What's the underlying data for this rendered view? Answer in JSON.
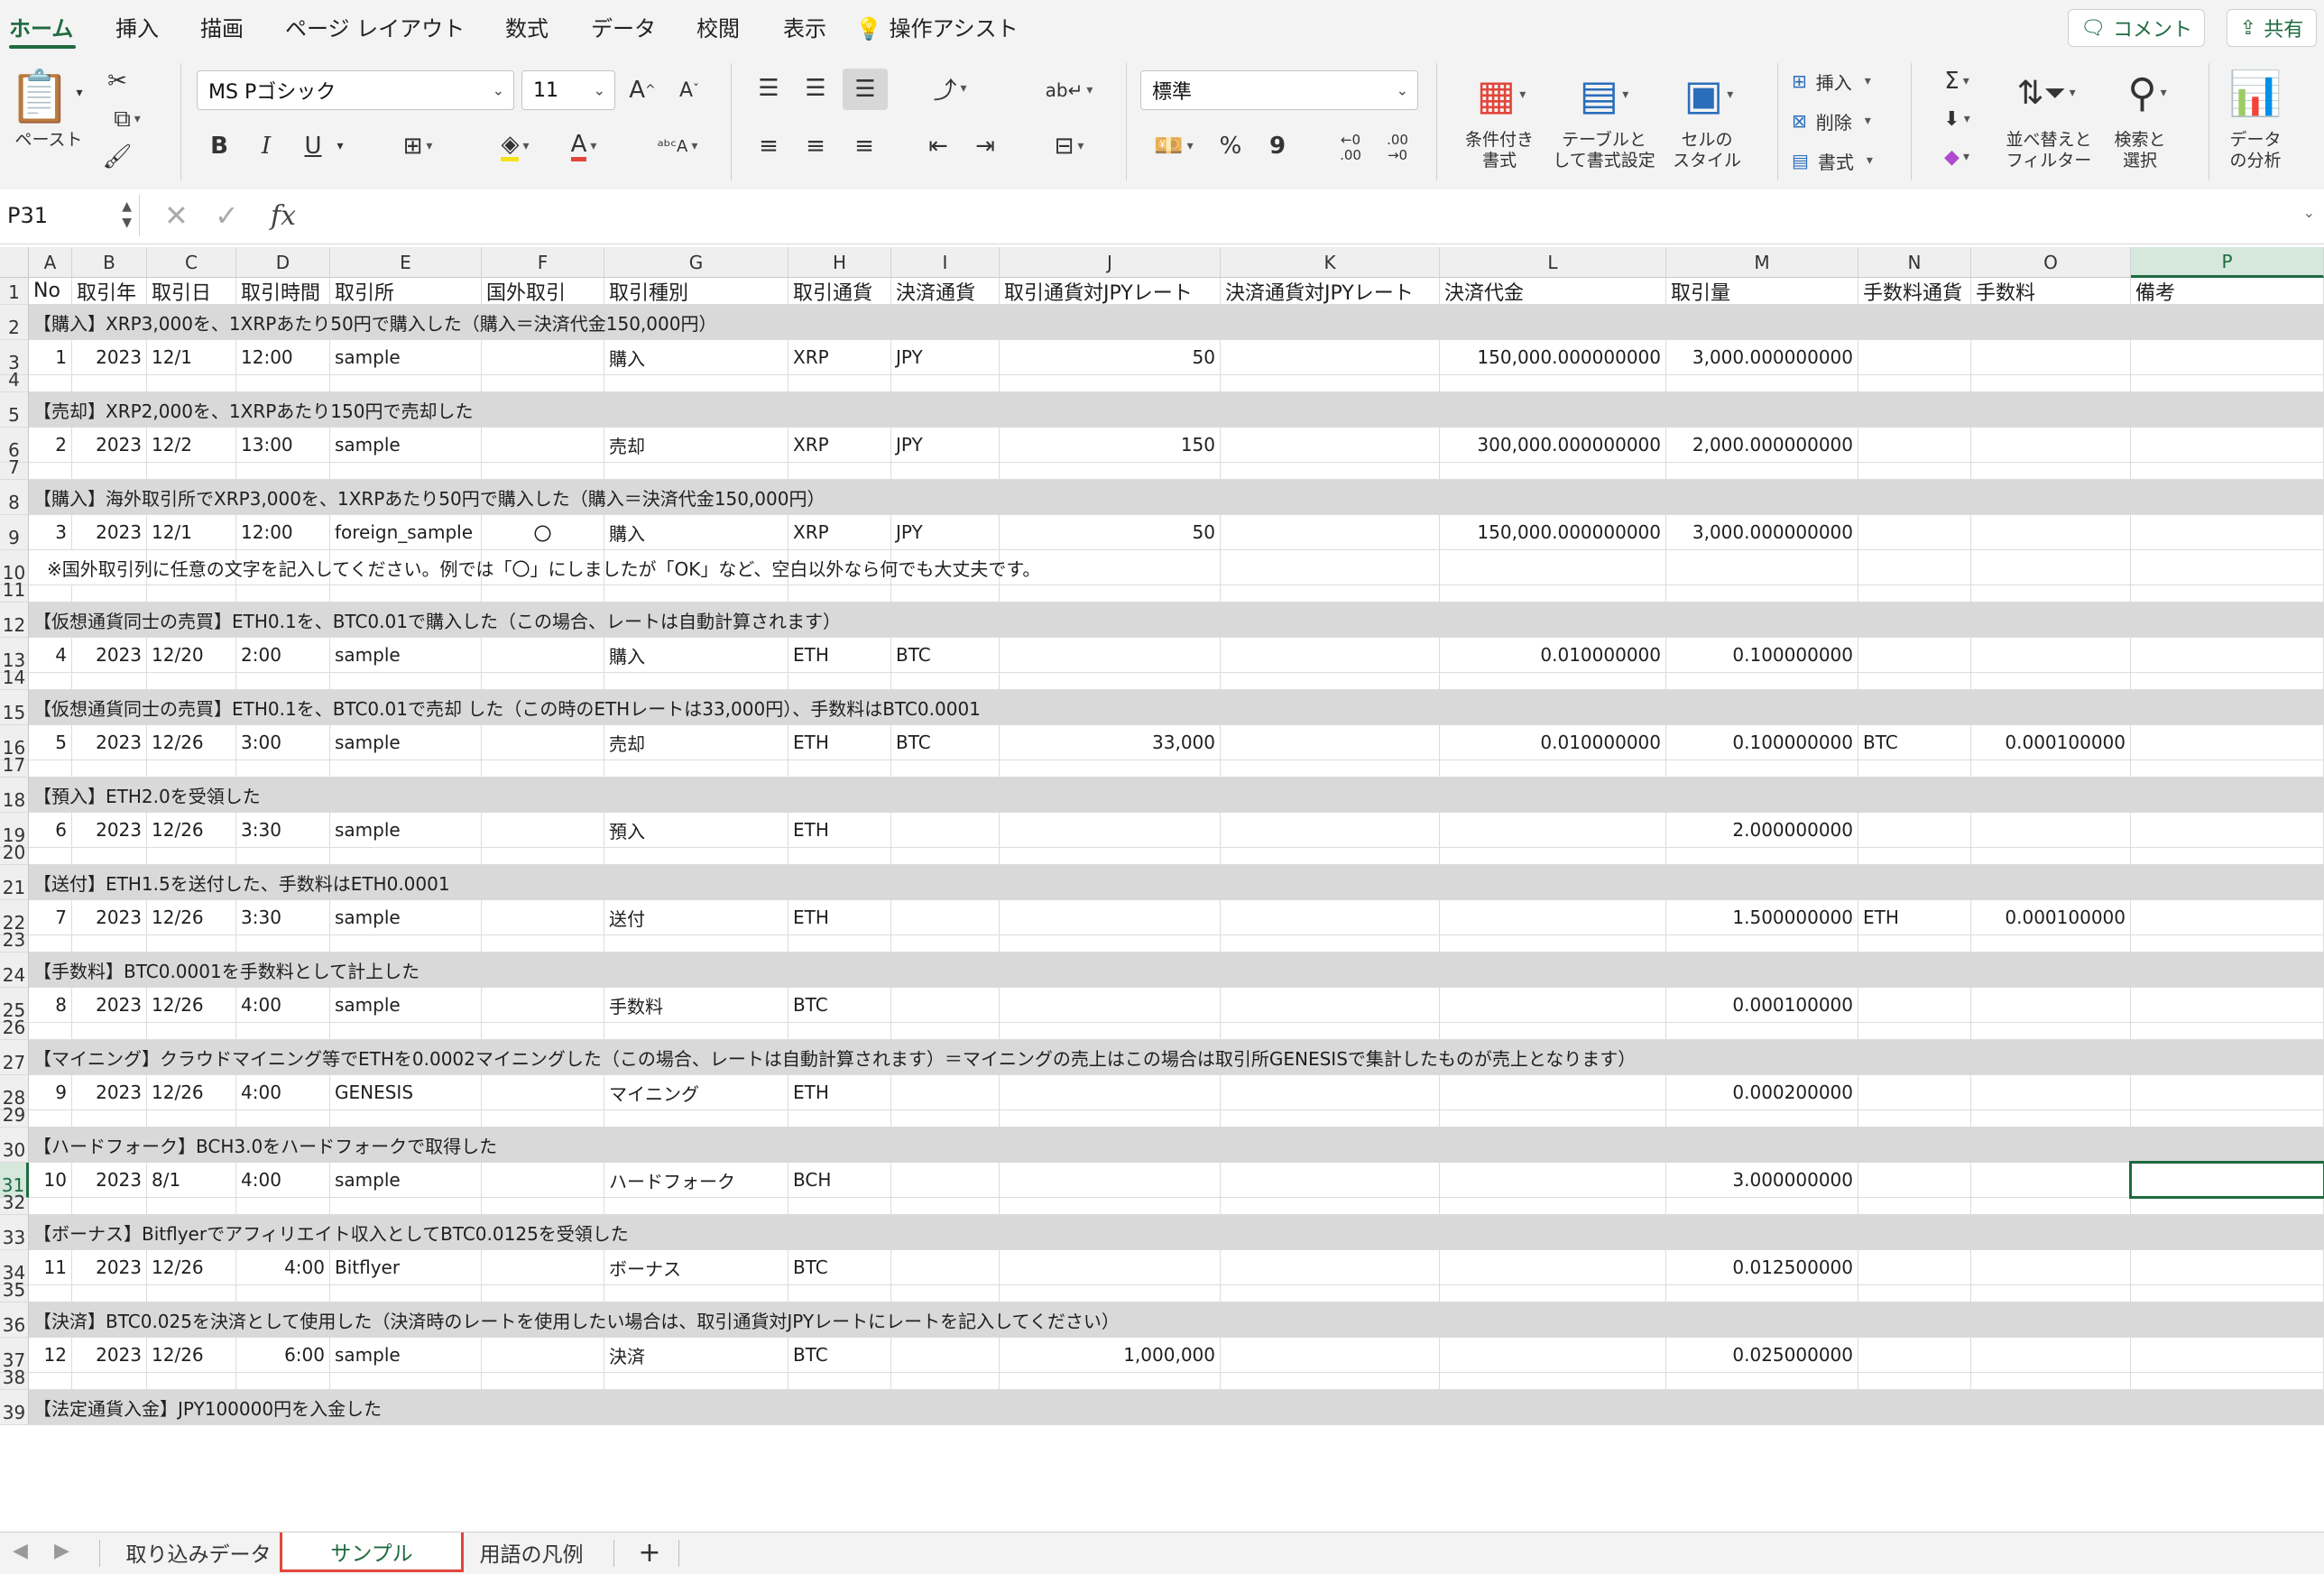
{
  "ribbon_tabs": [
    "ホーム",
    "挿入",
    "描画",
    "ページ レイアウト",
    "数式",
    "データ",
    "校閲",
    "表示",
    "操作アシスト"
  ],
  "top_buttons": {
    "comment": "コメント",
    "share": "共有"
  },
  "clipboard": {
    "paste_label": "ペースト"
  },
  "font": {
    "name": "MS Pゴシック",
    "size": "11",
    "bold": "B",
    "italic": "I",
    "underline": "U"
  },
  "number": {
    "format": "標準",
    "percent": "%",
    "comma": "9",
    "inc_decimal_from": "←0",
    "inc_decimal_to": ".00",
    "dec_decimal_from": ".00",
    "dec_decimal_to": "→0"
  },
  "styles": {
    "conditional": [
      "条件付き",
      "書式"
    ],
    "table": [
      "テーブルと",
      "して書式設定"
    ],
    "cell": [
      "セルの",
      "スタイル"
    ]
  },
  "cells_group": {
    "insert": "挿入",
    "delete": "削除",
    "format": "書式"
  },
  "editing": {
    "sort": [
      "並べ替えと",
      "フィルター"
    ],
    "find": [
      "検索と",
      "選択"
    ]
  },
  "analysis": {
    "label": [
      "データ",
      "の分析"
    ]
  },
  "formula_bar": {
    "name_box": "P31",
    "fx": "fx",
    "formula": ""
  },
  "colors": {
    "accent": "#1d6b3f",
    "band": "#d9d9d9",
    "highlight_red": "#e2463a",
    "fill_yellow": "#f5e21c"
  },
  "columns": [
    "A",
    "B",
    "C",
    "D",
    "E",
    "F",
    "G",
    "H",
    "I",
    "J",
    "K",
    "L",
    "M",
    "N",
    "O",
    "P"
  ],
  "selected_column": "P",
  "selected_row": 31,
  "header_row": [
    "No",
    "取引年",
    "取引日",
    "取引時間",
    "取引所",
    "国外取引",
    "取引種別",
    "取引通貨",
    "決済通貨",
    "取引通貨対JPYレート",
    "決済通貨対JPYレート",
    "決済代金",
    "取引量",
    "手数料通貨",
    "手数料",
    "備考"
  ],
  "rows": [
    {
      "n": 2,
      "type": "band",
      "text": "【購入】XRP3,000を、1XRPあたり50円で購入した（購入＝決済代金150,000円）"
    },
    {
      "n": 3,
      "type": "data",
      "cells": {
        "A": "1",
        "B": "2023",
        "C": "12/1",
        "D": "12:00",
        "E": "sample",
        "G": "購入",
        "H": "XRP",
        "I": "JPY",
        "J": "50",
        "L": "150,000.000000000",
        "M": "3,000.000000000"
      }
    },
    {
      "n": 4,
      "type": "empty"
    },
    {
      "n": 5,
      "type": "band",
      "text": "【売却】XRP2,000を、1XRPあたり150円で売却した"
    },
    {
      "n": 6,
      "type": "data",
      "cells": {
        "A": "2",
        "B": "2023",
        "C": "12/2",
        "D": "13:00",
        "E": "sample",
        "G": "売却",
        "H": "XRP",
        "I": "JPY",
        "J": "150",
        "L": "300,000.000000000",
        "M": "2,000.000000000"
      }
    },
    {
      "n": 7,
      "type": "empty"
    },
    {
      "n": 8,
      "type": "band",
      "text": "【購入】海外取引所でXRP3,000を、1XRPあたり50円で購入した（購入＝決済代金150,000円）"
    },
    {
      "n": 9,
      "type": "data",
      "cells": {
        "A": "3",
        "B": "2023",
        "C": "12/1",
        "D": "12:00",
        "E": "foreign_sample",
        "F": "〇",
        "G": "購入",
        "H": "XRP",
        "I": "JPY",
        "J": "50",
        "L": "150,000.000000000",
        "M": "3,000.000000000"
      }
    },
    {
      "n": 10,
      "type": "note",
      "text": "※国外取引列に任意の文字を記入してください。例では「〇」にしましたが「OK」など、空白以外なら何でも大丈夫です。"
    },
    {
      "n": 11,
      "type": "empty"
    },
    {
      "n": 12,
      "type": "band",
      "text": "【仮想通貨同士の売買】ETH0.1を、BTC0.01で購入した（この場合、レートは自動計算されます）"
    },
    {
      "n": 13,
      "type": "data",
      "cells": {
        "A": "4",
        "B": "2023",
        "C": "12/20",
        "D": "2:00",
        "E": "sample",
        "G": "購入",
        "H": "ETH",
        "I": "BTC",
        "L": "0.010000000",
        "M": "0.100000000"
      }
    },
    {
      "n": 14,
      "type": "empty"
    },
    {
      "n": 15,
      "type": "band",
      "text": "【仮想通貨同士の売買】ETH0.1を、BTC0.01で売却 した（この時のETHレートは33,000円）、手数料はBTC0.0001"
    },
    {
      "n": 16,
      "type": "data",
      "cells": {
        "A": "5",
        "B": "2023",
        "C": "12/26",
        "D": "3:00",
        "E": "sample",
        "G": "売却",
        "H": "ETH",
        "I": "BTC",
        "J": "33,000",
        "L": "0.010000000",
        "M": "0.100000000",
        "N": "BTC",
        "O": "0.000100000"
      }
    },
    {
      "n": 17,
      "type": "empty"
    },
    {
      "n": 18,
      "type": "band",
      "text": "【預入】ETH2.0を受領した"
    },
    {
      "n": 19,
      "type": "data",
      "cells": {
        "A": "6",
        "B": "2023",
        "C": "12/26",
        "D": "3:30",
        "E": "sample",
        "G": "預入",
        "H": "ETH",
        "M": "2.000000000"
      }
    },
    {
      "n": 20,
      "type": "empty"
    },
    {
      "n": 21,
      "type": "band",
      "text": "【送付】ETH1.5を送付した、手数料はETH0.0001"
    },
    {
      "n": 22,
      "type": "data",
      "cells": {
        "A": "7",
        "B": "2023",
        "C": "12/26",
        "D": "3:30",
        "E": "sample",
        "G": "送付",
        "H": "ETH",
        "M": "1.500000000",
        "N": "ETH",
        "O": "0.000100000"
      }
    },
    {
      "n": 23,
      "type": "empty"
    },
    {
      "n": 24,
      "type": "band",
      "text": "【手数料】BTC0.0001を手数料として計上した"
    },
    {
      "n": 25,
      "type": "data",
      "cells": {
        "A": "8",
        "B": "2023",
        "C": "12/26",
        "D": "4:00",
        "E": "sample",
        "G": "手数料",
        "H": "BTC",
        "M": "0.000100000"
      }
    },
    {
      "n": 26,
      "type": "empty"
    },
    {
      "n": 27,
      "type": "band",
      "text": "【マイニング】クラウドマイニング等でETHを0.0002マイニングした（この場合、レートは自動計算されます）＝マイニングの売上はこの場合は取引所GENESISで集計したものが売上となります）"
    },
    {
      "n": 28,
      "type": "data",
      "cells": {
        "A": "9",
        "B": "2023",
        "C": "12/26",
        "D": "4:00",
        "E": "GENESIS",
        "G": "マイニング",
        "H": "ETH",
        "M": "0.000200000"
      }
    },
    {
      "n": 29,
      "type": "empty"
    },
    {
      "n": 30,
      "type": "band",
      "text": "【ハードフォーク】BCH3.0をハードフォークで取得した"
    },
    {
      "n": 31,
      "type": "data",
      "cells": {
        "A": "10",
        "B": "2023",
        "C": "8/1",
        "D": "4:00",
        "E": "sample",
        "G": "ハードフォーク",
        "H": "BCH",
        "M": "3.000000000"
      }
    },
    {
      "n": 32,
      "type": "empty"
    },
    {
      "n": 33,
      "type": "band",
      "text": "【ボーナス】Bitflyerでアフィリエイト収入としてBTC0.0125を受領した"
    },
    {
      "n": 34,
      "type": "data",
      "time_right": true,
      "cells": {
        "A": "11",
        "B": "2023",
        "C": "12/26",
        "D": "4:00",
        "E": "Bitflyer",
        "G": "ボーナス",
        "H": "BTC",
        "M": "0.012500000"
      }
    },
    {
      "n": 35,
      "type": "empty"
    },
    {
      "n": 36,
      "type": "band",
      "text": "【決済】BTC0.025を決済として使用した（決済時のレートを使用したい場合は、取引通貨対JPYレートにレートを記入してください）"
    },
    {
      "n": 37,
      "type": "data",
      "time_right": true,
      "cells": {
        "A": "12",
        "B": "2023",
        "C": "12/26",
        "D": "6:00",
        "E": "sample",
        "G": "決済",
        "H": "BTC",
        "J": "1,000,000",
        "M": "0.025000000"
      }
    },
    {
      "n": 38,
      "type": "empty"
    },
    {
      "n": 39,
      "type": "band",
      "text": "【法定通貨入金】JPY100000円を入金した"
    }
  ],
  "sheet_tabs": {
    "tabs": [
      "取り込みデータ",
      "サンプル",
      "用語の凡例"
    ],
    "active": "サンプル",
    "add": "+"
  }
}
